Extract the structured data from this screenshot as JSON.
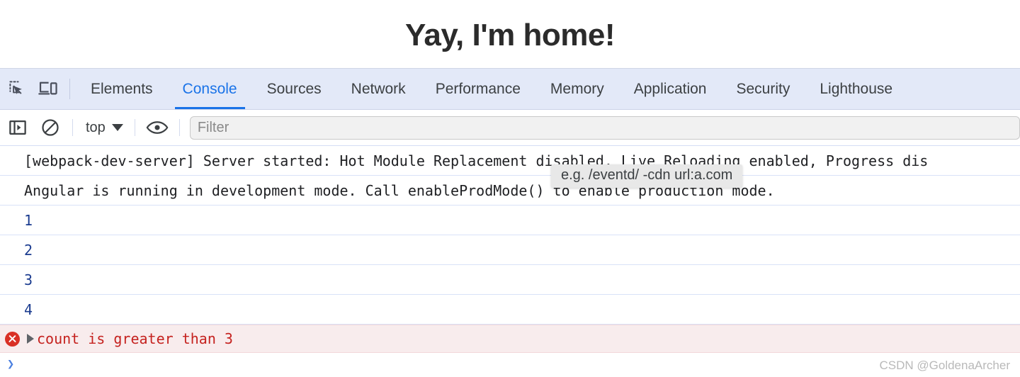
{
  "page": {
    "title": "Yay, I'm home!"
  },
  "devtools": {
    "icons": {
      "inspect": "inspect-element-icon",
      "device": "device-toolbar-icon"
    },
    "tabs": [
      {
        "label": "Elements",
        "active": false
      },
      {
        "label": "Console",
        "active": true
      },
      {
        "label": "Sources",
        "active": false
      },
      {
        "label": "Network",
        "active": false
      },
      {
        "label": "Performance",
        "active": false
      },
      {
        "label": "Memory",
        "active": false
      },
      {
        "label": "Application",
        "active": false
      },
      {
        "label": "Security",
        "active": false
      },
      {
        "label": "Lighthouse",
        "active": false
      }
    ],
    "accent_color": "#1a73e8",
    "tabbar_bg": "#e3e9f8"
  },
  "console_toolbar": {
    "sidebar_toggle": "show-console-sidebar-icon",
    "clear_console": "clear-console-icon",
    "context": "top",
    "eye_icon": "live-expression-icon",
    "filter_placeholder": "Filter"
  },
  "tooltip": {
    "text": "e.g. /eventd/ -cdn url:a.com"
  },
  "console_messages": [
    {
      "type": "log",
      "text": "[webpack-dev-server] Server started: Hot Module Replacement disabled, Live Reloading enabled, Progress dis"
    },
    {
      "type": "log",
      "text": "Angular is running in development mode. Call enableProdMode() to enable production mode."
    },
    {
      "type": "number",
      "text": "1"
    },
    {
      "type": "number",
      "text": "2"
    },
    {
      "type": "number",
      "text": "3"
    },
    {
      "type": "number",
      "text": "4"
    }
  ],
  "error_message": {
    "icon": "error-icon",
    "disclosure": "expand-triangle-icon",
    "text": "count is greater than 3",
    "color": "#c5221f",
    "background": "#f8eced"
  },
  "prompt": {
    "arrow": "❯"
  },
  "watermark": {
    "text": "CSDN @GoldenaArcher"
  }
}
